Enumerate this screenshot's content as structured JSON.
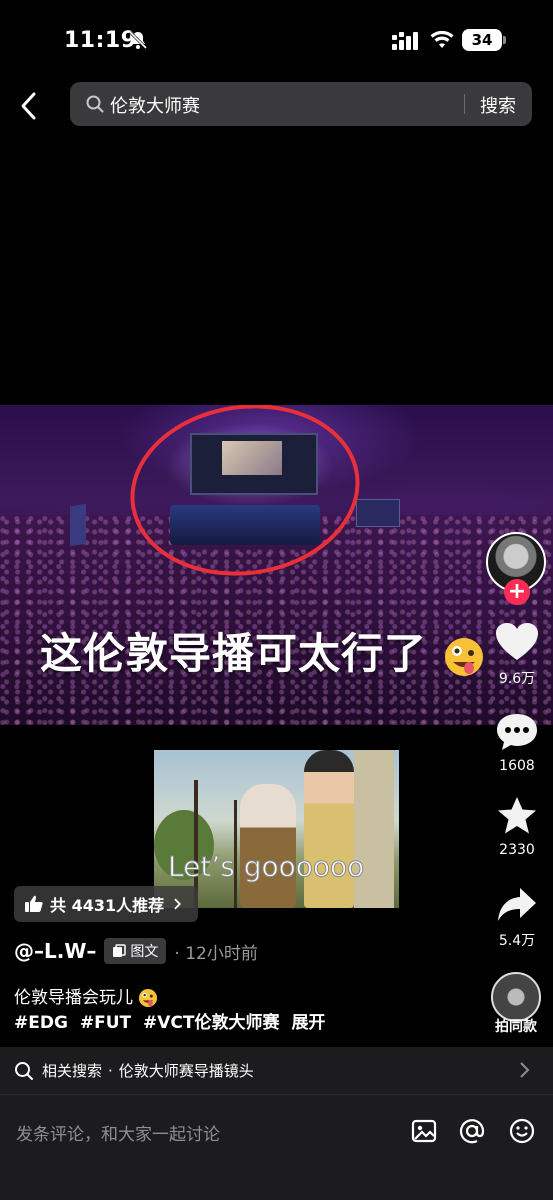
{
  "status_bar": {
    "time": "11:19",
    "battery": "34",
    "icons": [
      "bell-off-icon",
      "signal-icon",
      "wifi-icon",
      "battery-icon"
    ]
  },
  "search": {
    "query": "伦敦大师赛",
    "submit_label": "搜索"
  },
  "post": {
    "overlay_caption": "这伦敦导播可太行了",
    "sticker_text": "Let’s goooooo",
    "recommend_label": "共 4431人推荐",
    "author": "@–L.W–",
    "type_badge": "图文",
    "time_ago": "· 12小时前",
    "description": "伦敦导播会玩儿",
    "hashtags": [
      "#EDG",
      "#FUT",
      "#VCT伦敦大师赛"
    ],
    "expand_label": "展开"
  },
  "actions": {
    "likes": "9.6万",
    "comments": "1608",
    "favorites": "2330",
    "shares": "5.4万",
    "same_style_label": "拍同款"
  },
  "related_search": {
    "label": "相关搜索",
    "separator": "·",
    "term": "伦敦大师赛导播镜头"
  },
  "comment_bar": {
    "placeholder": "发条评论，和大家一起讨论"
  },
  "colors": {
    "accent_red": "#fe2c55",
    "annotation_red": "#e8303a",
    "bar_bg": "#1c1c1e"
  }
}
